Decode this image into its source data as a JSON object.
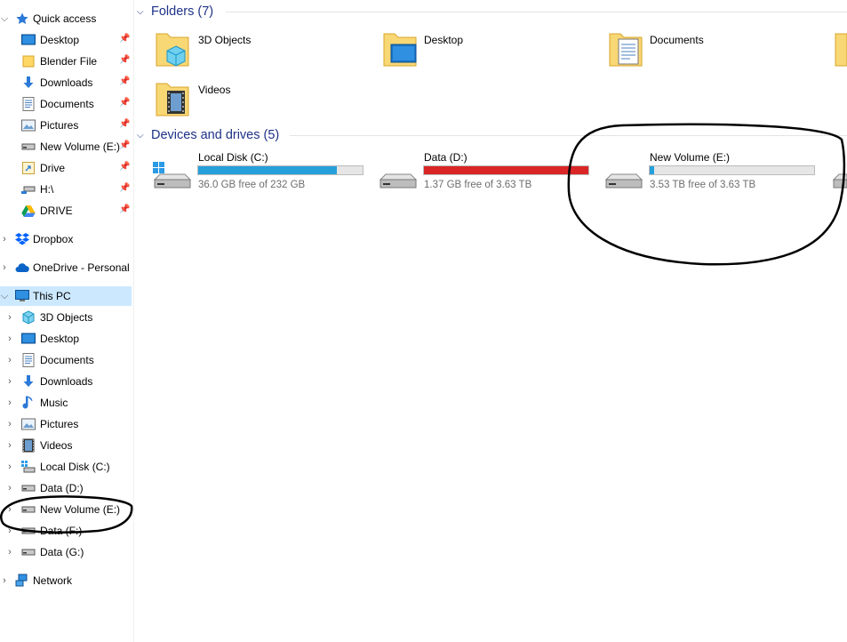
{
  "sidebar": {
    "quick_access": "Quick access",
    "qa_items": [
      {
        "label": "Desktop"
      },
      {
        "label": "Blender File"
      },
      {
        "label": "Downloads"
      },
      {
        "label": "Documents"
      },
      {
        "label": "Pictures"
      },
      {
        "label": "New Volume (E:)"
      },
      {
        "label": "Drive"
      },
      {
        "label": "H:\\"
      },
      {
        "label": "DRIVE"
      }
    ],
    "dropbox": "Dropbox",
    "onedrive": "OneDrive - Personal",
    "this_pc": "This PC",
    "pc_items": [
      {
        "label": "3D Objects"
      },
      {
        "label": "Desktop"
      },
      {
        "label": "Documents"
      },
      {
        "label": "Downloads"
      },
      {
        "label": "Music"
      },
      {
        "label": "Pictures"
      },
      {
        "label": "Videos"
      },
      {
        "label": "Local Disk (C:)"
      },
      {
        "label": "Data (D:)"
      },
      {
        "label": "New Volume (E:)"
      },
      {
        "label": "Data (F:)"
      },
      {
        "label": "Data (G:)"
      }
    ],
    "network": "Network"
  },
  "main": {
    "folders_header": "Folders (7)",
    "folders": [
      {
        "label": "3D Objects"
      },
      {
        "label": "Desktop"
      },
      {
        "label": "Documents"
      },
      {
        "label": "Videos"
      }
    ],
    "drives_header": "Devices and drives (5)",
    "drives": [
      {
        "label": "Local Disk (C:)",
        "free": "36.0 GB free of 232 GB",
        "used_fraction": 0.845,
        "bar_color": "#26a0da"
      },
      {
        "label": "Data (D:)",
        "free": "1.37 GB free of 3.63 TB",
        "used_fraction": 0.9996,
        "bar_color": "#da2626"
      },
      {
        "label": "New Volume (E:)",
        "free": "3.53 TB free of 3.63 TB",
        "used_fraction": 0.028,
        "bar_color": "#26a0da"
      }
    ]
  },
  "colors": {
    "selection": "#cce8ff",
    "group_header": "#1e3287",
    "bar_normal": "#26a0da",
    "bar_full": "#da2626",
    "annotation": "#000000"
  }
}
